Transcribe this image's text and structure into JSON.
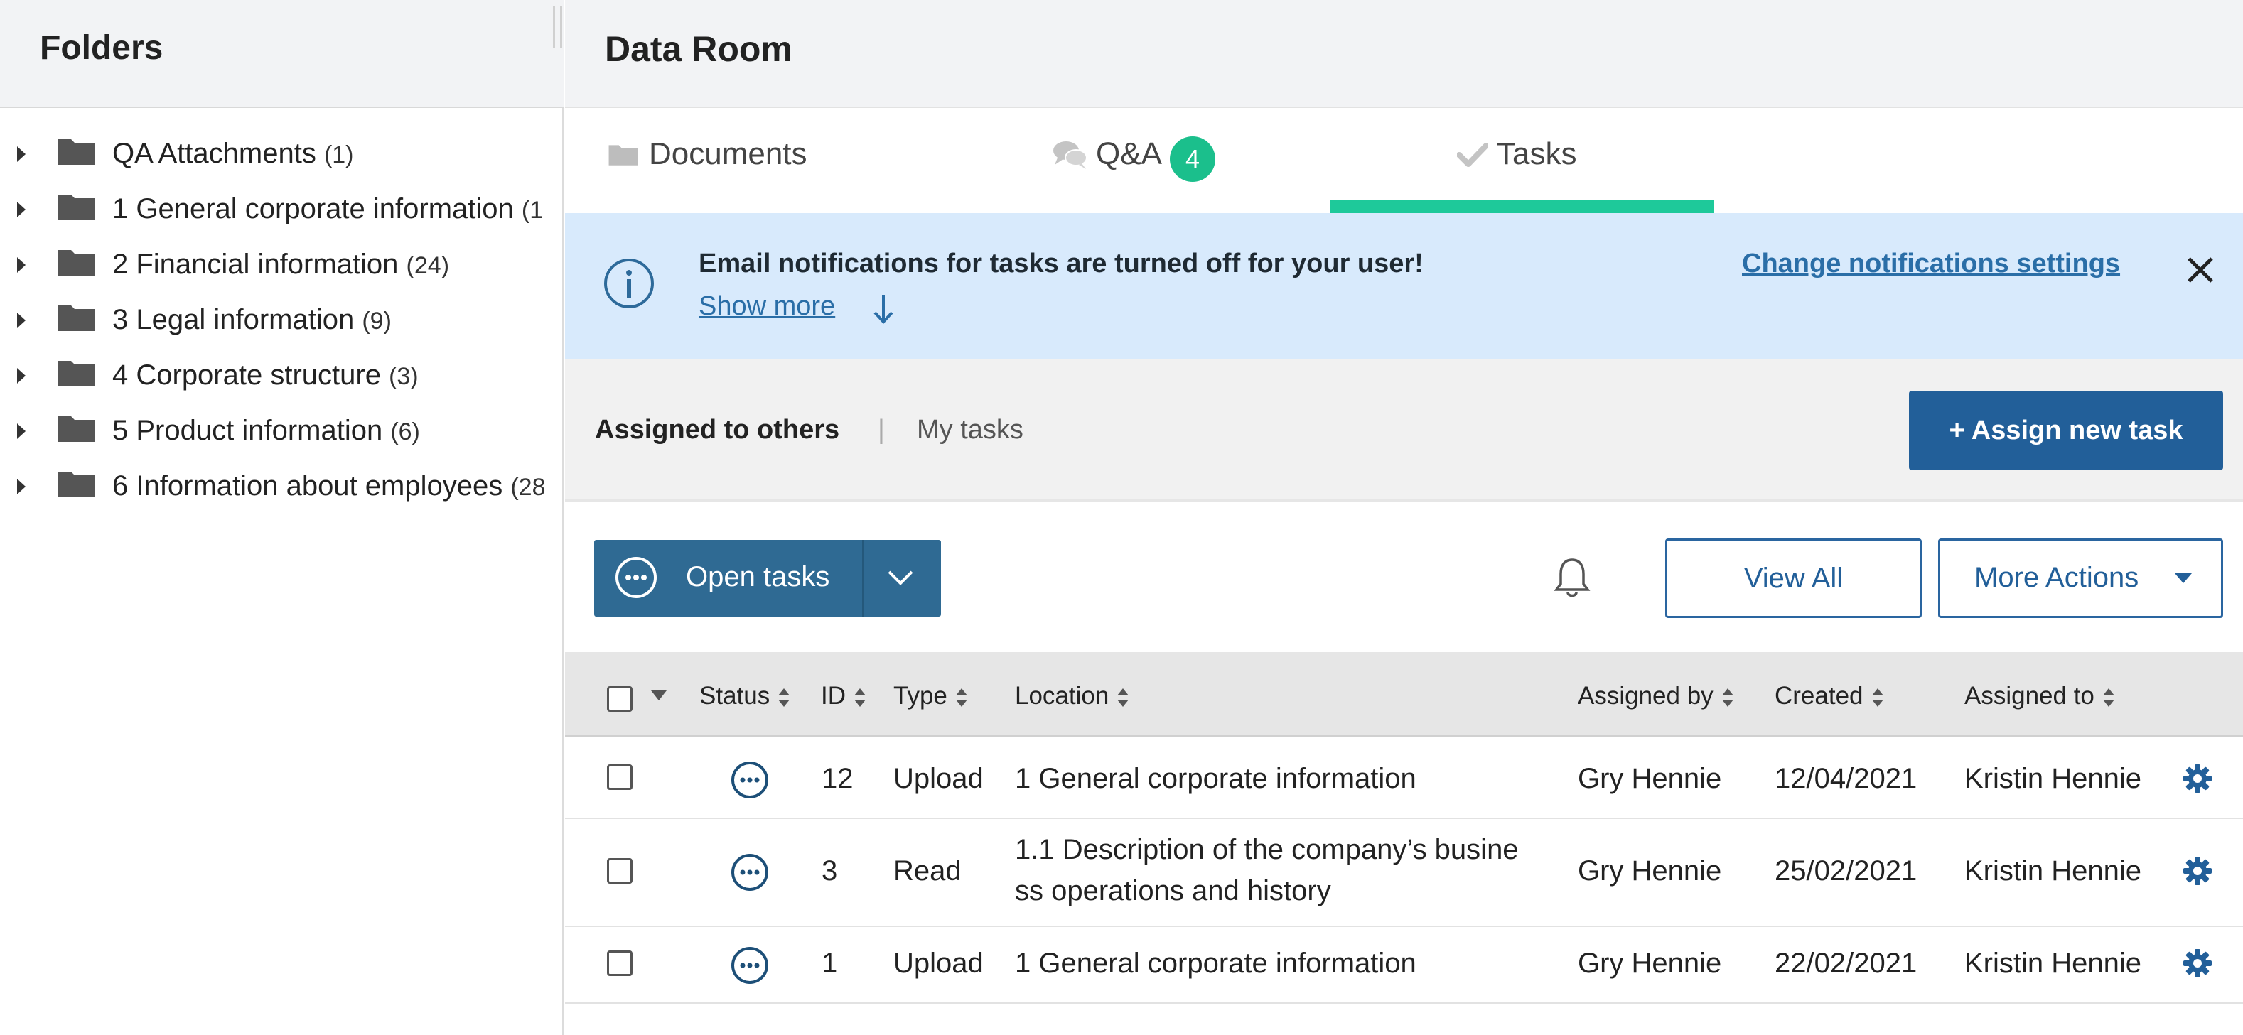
{
  "left_panel": {
    "title": "Folders",
    "folders": [
      {
        "label": "QA Attachments",
        "count": "(1)"
      },
      {
        "label": "1 General corporate information",
        "count": "(1"
      },
      {
        "label": "2 Financial information",
        "count": "(24)"
      },
      {
        "label": "3 Legal information",
        "count": "(9)"
      },
      {
        "label": "4 Corporate structure",
        "count": "(3)"
      },
      {
        "label": "5 Product information",
        "count": "(6)"
      },
      {
        "label": "6 Information about employees",
        "count": "(28"
      }
    ]
  },
  "header": {
    "title": "Data Room"
  },
  "tabs": [
    {
      "label": "Documents",
      "icon": "folder-icon"
    },
    {
      "label": "Q&A",
      "icon": "chat-bubbles-icon",
      "badge": "4"
    },
    {
      "label": "Tasks",
      "icon": "checkmark-icon",
      "active": true
    }
  ],
  "banner": {
    "message": "Email notifications for tasks are turned off for your user!",
    "show_more": "Show more",
    "link": "Change notifications settings",
    "icon": "info-circle-icon",
    "close_icon": "close-icon"
  },
  "subnav": {
    "assigned_to_others": "Assigned to others",
    "separator": "|",
    "my_tasks": "My tasks",
    "assign_button": "+ Assign new task"
  },
  "toolbar": {
    "open_tasks": "Open tasks",
    "view_all": "View All",
    "more_actions": "More Actions",
    "bell_icon": "bell-icon"
  },
  "table": {
    "columns": [
      "Status",
      "ID",
      "Type",
      "Location",
      "Assigned by",
      "Created",
      "Assigned to"
    ],
    "rows": [
      {
        "id": "12",
        "type": "Upload",
        "location": [
          "1 General corporate information"
        ],
        "assigned_by": "Gry Hennie",
        "created": "12/04/2021",
        "assigned_to": "Kristin Hennie"
      },
      {
        "id": "3",
        "type": "Read",
        "location": [
          "1.1 Description of the company’s busine",
          "ss operations and history"
        ],
        "assigned_by": "Gry Hennie",
        "created": "25/02/2021",
        "assigned_to": "Kristin Hennie"
      },
      {
        "id": "1",
        "type": "Upload",
        "location": [
          "1 General corporate information"
        ],
        "assigned_by": "Gry Hennie",
        "created": "22/02/2021",
        "assigned_to": "Kristin Hennie"
      }
    ]
  },
  "colors": {
    "accent_green": "#1ec99a",
    "primary_blue": "#225f99",
    "banner_bg": "#d8eafc",
    "open_tasks_bg": "#2f6a93"
  }
}
